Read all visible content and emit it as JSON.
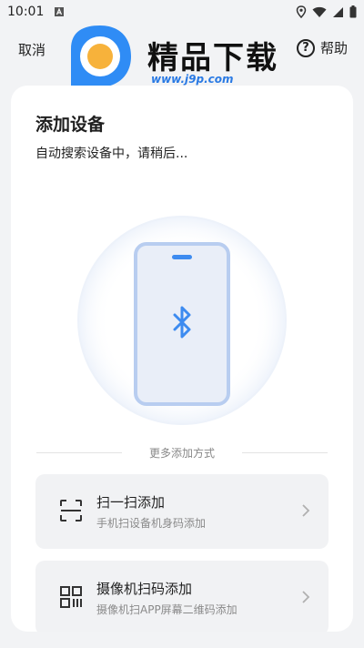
{
  "status_bar": {
    "time": "10:01",
    "icons": [
      "a-notification-icon",
      "location-icon",
      "wifi-icon",
      "signal-icon",
      "battery-icon"
    ]
  },
  "top_bar": {
    "cancel_label": "取消",
    "help_label": "帮助",
    "help_symbol": "?"
  },
  "watermark": {
    "title": "精品下载",
    "url": "www.j9p.com"
  },
  "card": {
    "title": "添加设备",
    "subtitle": "自动搜索设备中，请稍后...",
    "device_icon": "bluetooth-icon",
    "divider_label": "更多添加方式",
    "options": [
      {
        "icon": "scan-icon",
        "title": "扫一扫添加",
        "desc": "手机扫设备机身码添加"
      },
      {
        "icon": "qr-code-icon",
        "title": "摄像机扫码添加",
        "desc": "摄像机扫APP屏幕二维码添加"
      }
    ]
  },
  "colors": {
    "accent": "#3d8bf0",
    "phone_fill": "#e9eef8",
    "phone_stroke": "#b8cdf0",
    "card_bg": "#ffffff",
    "option_bg": "#f1f2f4",
    "page_bg": "#f2f3f5"
  }
}
